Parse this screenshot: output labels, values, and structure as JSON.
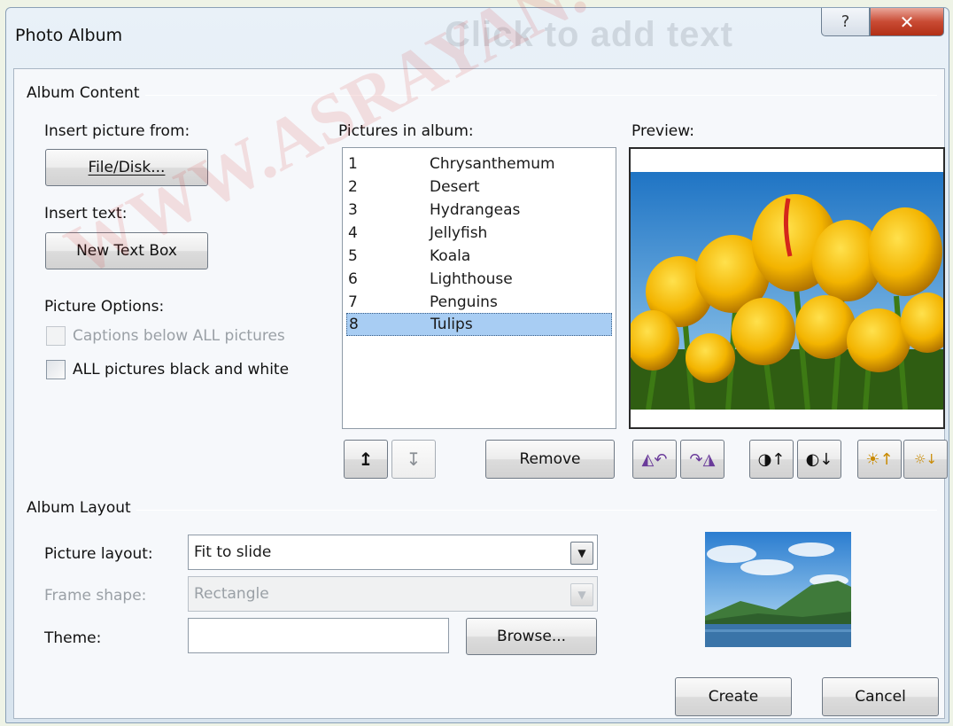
{
  "window": {
    "title": "Photo Album",
    "background_text": "Click to add text",
    "help_icon": "question-icon",
    "close_icon": "close-icon"
  },
  "album_content": {
    "group_label": "Album Content",
    "insert_picture_label": "Insert picture from:",
    "file_disk_button": "File/Disk...",
    "insert_text_label": "Insert text:",
    "new_text_box_button": "New Text Box",
    "picture_options_label": "Picture Options:",
    "captions_option": {
      "label": "Captions below ALL pictures",
      "checked": false,
      "enabled": false
    },
    "black_white_option": {
      "label": "ALL pictures black and white",
      "checked": false,
      "enabled": true
    },
    "pictures_label": "Pictures in album:",
    "pictures": [
      {
        "num": "1",
        "name": "Chrysanthemum",
        "selected": false
      },
      {
        "num": "2",
        "name": "Desert",
        "selected": false
      },
      {
        "num": "3",
        "name": "Hydrangeas",
        "selected": false
      },
      {
        "num": "4",
        "name": "Jellyfish",
        "selected": false
      },
      {
        "num": "5",
        "name": "Koala",
        "selected": false
      },
      {
        "num": "6",
        "name": "Lighthouse",
        "selected": false
      },
      {
        "num": "7",
        "name": "Penguins",
        "selected": false
      },
      {
        "num": "8",
        "name": "Tulips",
        "selected": true
      }
    ],
    "move_up_icon": "arrow-up-icon",
    "move_down_icon": "arrow-down-icon",
    "remove_button": "Remove",
    "preview_label": "Preview:",
    "preview_tools": [
      "rotate-left-icon",
      "rotate-right-icon",
      "contrast-up-icon",
      "contrast-down-icon",
      "brightness-up-icon",
      "brightness-down-icon"
    ]
  },
  "album_layout": {
    "group_label": "Album Layout",
    "picture_layout_label": "Picture layout:",
    "picture_layout_value": "Fit to slide",
    "frame_shape_label": "Frame shape:",
    "frame_shape_value": "Rectangle",
    "theme_label": "Theme:",
    "theme_value": "",
    "browse_button": "Browse..."
  },
  "footer": {
    "create_button": "Create",
    "cancel_button": "Cancel"
  },
  "watermark_text": "WWW.ASRAYAN.COM",
  "colors": {
    "selection": "#a8cdf3",
    "close_button": "#c94b34",
    "watermark": "#d22828"
  }
}
